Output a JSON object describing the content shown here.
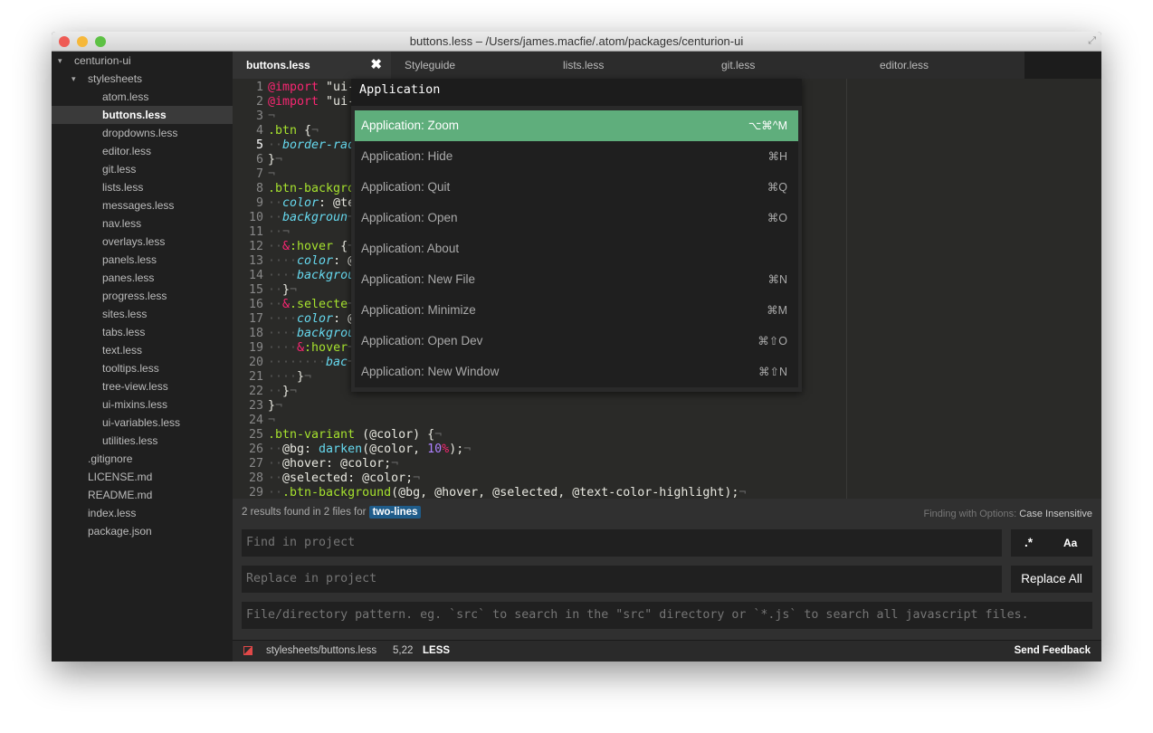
{
  "window": {
    "title": "buttons.less – /Users/james.macfie/.atom/packages/centurion-ui"
  },
  "tree": [
    {
      "label": "centurion-ui",
      "level": 0,
      "type": "folder"
    },
    {
      "label": "stylesheets",
      "level": 1,
      "type": "folder"
    },
    {
      "label": "atom.less",
      "level": 2
    },
    {
      "label": "buttons.less",
      "level": 2,
      "selected": true
    },
    {
      "label": "dropdowns.less",
      "level": 2
    },
    {
      "label": "editor.less",
      "level": 2
    },
    {
      "label": "git.less",
      "level": 2
    },
    {
      "label": "lists.less",
      "level": 2
    },
    {
      "label": "messages.less",
      "level": 2
    },
    {
      "label": "nav.less",
      "level": 2
    },
    {
      "label": "overlays.less",
      "level": 2
    },
    {
      "label": "panels.less",
      "level": 2
    },
    {
      "label": "panes.less",
      "level": 2
    },
    {
      "label": "progress.less",
      "level": 2
    },
    {
      "label": "sites.less",
      "level": 2
    },
    {
      "label": "tabs.less",
      "level": 2
    },
    {
      "label": "text.less",
      "level": 2
    },
    {
      "label": "tooltips.less",
      "level": 2
    },
    {
      "label": "tree-view.less",
      "level": 2
    },
    {
      "label": "ui-mixins.less",
      "level": 2
    },
    {
      "label": "ui-variables.less",
      "level": 2
    },
    {
      "label": "utilities.less",
      "level": 2
    },
    {
      "label": ".gitignore",
      "level": 1
    },
    {
      "label": "LICENSE.md",
      "level": 1
    },
    {
      "label": "README.md",
      "level": 1
    },
    {
      "label": "index.less",
      "level": 1
    },
    {
      "label": "package.json",
      "level": 1
    }
  ],
  "tabs": [
    {
      "label": "buttons.less",
      "active": true,
      "close": "✖"
    },
    {
      "label": "Styleguide"
    },
    {
      "label": "lists.less"
    },
    {
      "label": "git.less"
    },
    {
      "label": "editor.less"
    }
  ],
  "editor": {
    "current_line": 5,
    "lines": [
      [
        [
          "k",
          "@import"
        ],
        [
          "t",
          " \"ui-"
        ]
      ],
      [
        [
          "k",
          "@import"
        ],
        [
          "t",
          " \"ui-"
        ]
      ],
      [],
      [
        [
          "s",
          ".btn"
        ],
        [
          "t",
          " {"
        ]
      ],
      [
        [
          "i",
          "··"
        ],
        [
          "p",
          "border-rad"
        ]
      ],
      [
        [
          "t",
          "}"
        ]
      ],
      [],
      [
        [
          "s",
          ".btn-backgro"
        ]
      ],
      [
        [
          "i",
          "··"
        ],
        [
          "p",
          "color"
        ],
        [
          "t",
          ": @te"
        ]
      ],
      [
        [
          "i",
          "··"
        ],
        [
          "p",
          "backgroun"
        ]
      ],
      [
        [
          "i",
          "··"
        ]
      ],
      [
        [
          "i",
          "··"
        ],
        [
          "k",
          "&"
        ],
        [
          "s",
          ":hover"
        ],
        [
          "t",
          " {"
        ]
      ],
      [
        [
          "i",
          "····"
        ],
        [
          "p",
          "color"
        ],
        [
          "t",
          ": @"
        ]
      ],
      [
        [
          "i",
          "····"
        ],
        [
          "p",
          "backgrou"
        ]
      ],
      [
        [
          "i",
          "··"
        ],
        [
          "t",
          "}"
        ]
      ],
      [
        [
          "i",
          "··"
        ],
        [
          "k",
          "&"
        ],
        [
          "s",
          ".selecte"
        ]
      ],
      [
        [
          "i",
          "····"
        ],
        [
          "p",
          "color"
        ],
        [
          "t",
          ": @"
        ]
      ],
      [
        [
          "i",
          "····"
        ],
        [
          "p",
          "backgrou"
        ]
      ],
      [
        [
          "i",
          "····"
        ],
        [
          "k",
          "&"
        ],
        [
          "s",
          ":hover"
        ]
      ],
      [
        [
          "i",
          "········"
        ],
        [
          "p",
          "bac"
        ]
      ],
      [
        [
          "i",
          "····"
        ],
        [
          "t",
          "}"
        ]
      ],
      [
        [
          "i",
          "··"
        ],
        [
          "t",
          "}"
        ]
      ],
      [
        [
          "t",
          "}"
        ]
      ],
      [],
      [
        [
          "s",
          ".btn-variant"
        ],
        [
          "t",
          " (@color) {"
        ]
      ],
      [
        [
          "i",
          "··"
        ],
        [
          "t",
          "@bg: "
        ],
        [
          "f",
          "darken"
        ],
        [
          "t",
          "(@color, "
        ],
        [
          "n",
          "10"
        ],
        [
          "k",
          "%"
        ],
        [
          "t",
          ");"
        ]
      ],
      [
        [
          "i",
          "··"
        ],
        [
          "t",
          "@hover: @color;"
        ]
      ],
      [
        [
          "i",
          "··"
        ],
        [
          "t",
          "@selected: @color;"
        ]
      ],
      [
        [
          "i",
          "··"
        ],
        [
          "s",
          ".btn-background"
        ],
        [
          "t",
          "(@bg, @hover, @selected, @text-color-highlight);"
        ]
      ]
    ]
  },
  "palette": {
    "query": "Application",
    "items": [
      {
        "label": "Application: Zoom",
        "key": "⌥⌘^M",
        "selected": true
      },
      {
        "label": "Application: Hide",
        "key": "⌘H"
      },
      {
        "label": "Application: Quit",
        "key": "⌘Q"
      },
      {
        "label": "Application: Open",
        "key": "⌘O"
      },
      {
        "label": "Application: About",
        "key": ""
      },
      {
        "label": "Application: New File",
        "key": "⌘N"
      },
      {
        "label": "Application: Minimize",
        "key": "⌘M"
      },
      {
        "label": "Application: Open Dev",
        "key": "⌘⇧O"
      },
      {
        "label": "Application: New Window",
        "key": "⌘⇧N"
      }
    ]
  },
  "find": {
    "summary_prefix": "2 results found in 2 files for",
    "term": "two-lines",
    "options_label": "Finding with Options:",
    "options_value": "Case Insensitive",
    "find_placeholder": "Find in project",
    "replace_placeholder": "Replace in project",
    "pattern_placeholder": "File/directory pattern. eg. `src` to search in the \"src\" directory or `*.js` to search all javascript files.",
    "regex_label": ".*",
    "case_label": "Aa",
    "replace_all": "Replace All"
  },
  "status": {
    "path": "stylesheets/buttons.less",
    "cursor": "5,22",
    "grammar": "LESS",
    "feedback": "Send Feedback"
  },
  "colors": {
    "accent": "#5fae7c",
    "selection_tag": "#1f5c8a",
    "modified_icon": "#e04848"
  }
}
